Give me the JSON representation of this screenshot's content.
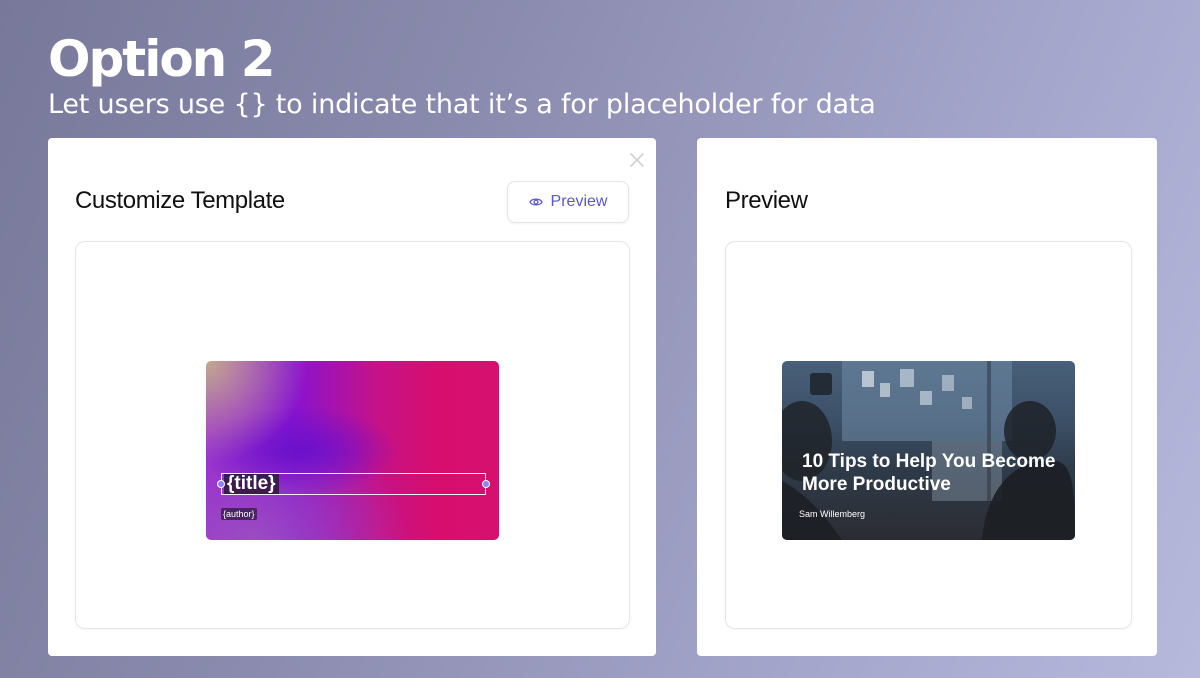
{
  "page": {
    "title": "Option 2",
    "subtitle": "Let users use {} to indicate that it’s a for placeholder for data"
  },
  "editor": {
    "title": "Customize Template",
    "preview_button_label": "Preview",
    "close_icon": "close-icon",
    "preview_icon": "eye-icon",
    "template": {
      "title_placeholder": "{title}",
      "author_placeholder": "{author}"
    }
  },
  "preview": {
    "title": "Preview",
    "card": {
      "title": "10 Tips to Help You Become More Productive",
      "author": "Sam Willemberg"
    }
  },
  "colors": {
    "accent": "#5a57c9",
    "handle": "#8a82ff",
    "gradient_magenta": "#d80e6d",
    "gradient_violet": "#6a10cc"
  }
}
